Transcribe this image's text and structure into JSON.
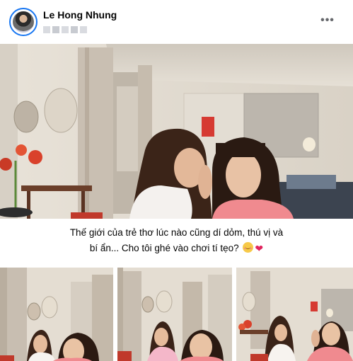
{
  "author": {
    "name": "Le Hong Nhung"
  },
  "post": {
    "caption_line1": "Thế giới của trẻ thơ lúc nào cũng dí dỏm, thú vị và",
    "caption_line2": "bí ẩn... Cho tôi ghé vào chơi tí tẹo?"
  },
  "icons": {
    "more": "more-options-icon",
    "smile": "smiling-face-icon",
    "heart": "red-heart-icon"
  },
  "heart_glyph": "❤",
  "more_glyph": "•••",
  "colors": {
    "accent": "#1877f2",
    "heart": "#e0245e"
  }
}
